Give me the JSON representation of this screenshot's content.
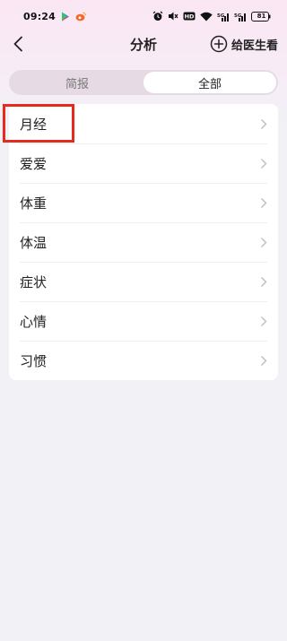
{
  "status_bar": {
    "time": "09:24",
    "battery": "81",
    "icons": [
      "play-store-icon",
      "weibo-icon",
      "alarm-icon",
      "mute-icon",
      "hd-icon",
      "wifi-icon",
      "signal-icon",
      "signal-icon",
      "battery-icon"
    ]
  },
  "nav": {
    "title": "分析",
    "share_label": "给医生看",
    "back_icon": "chevron-left-icon",
    "share_icon": "plus-circle-icon"
  },
  "segment": {
    "tabs": [
      {
        "label": "简报",
        "active": false
      },
      {
        "label": "全部",
        "active": true
      }
    ]
  },
  "list": {
    "items": [
      {
        "label": "月经"
      },
      {
        "label": "爱爱"
      },
      {
        "label": "体重"
      },
      {
        "label": "体温"
      },
      {
        "label": "症状"
      },
      {
        "label": "心情"
      },
      {
        "label": "习惯"
      }
    ]
  },
  "colors": {
    "highlight": "#e62a1e",
    "segment_bg": "#e6dbe4",
    "page_bg": "#f2f1f5"
  }
}
